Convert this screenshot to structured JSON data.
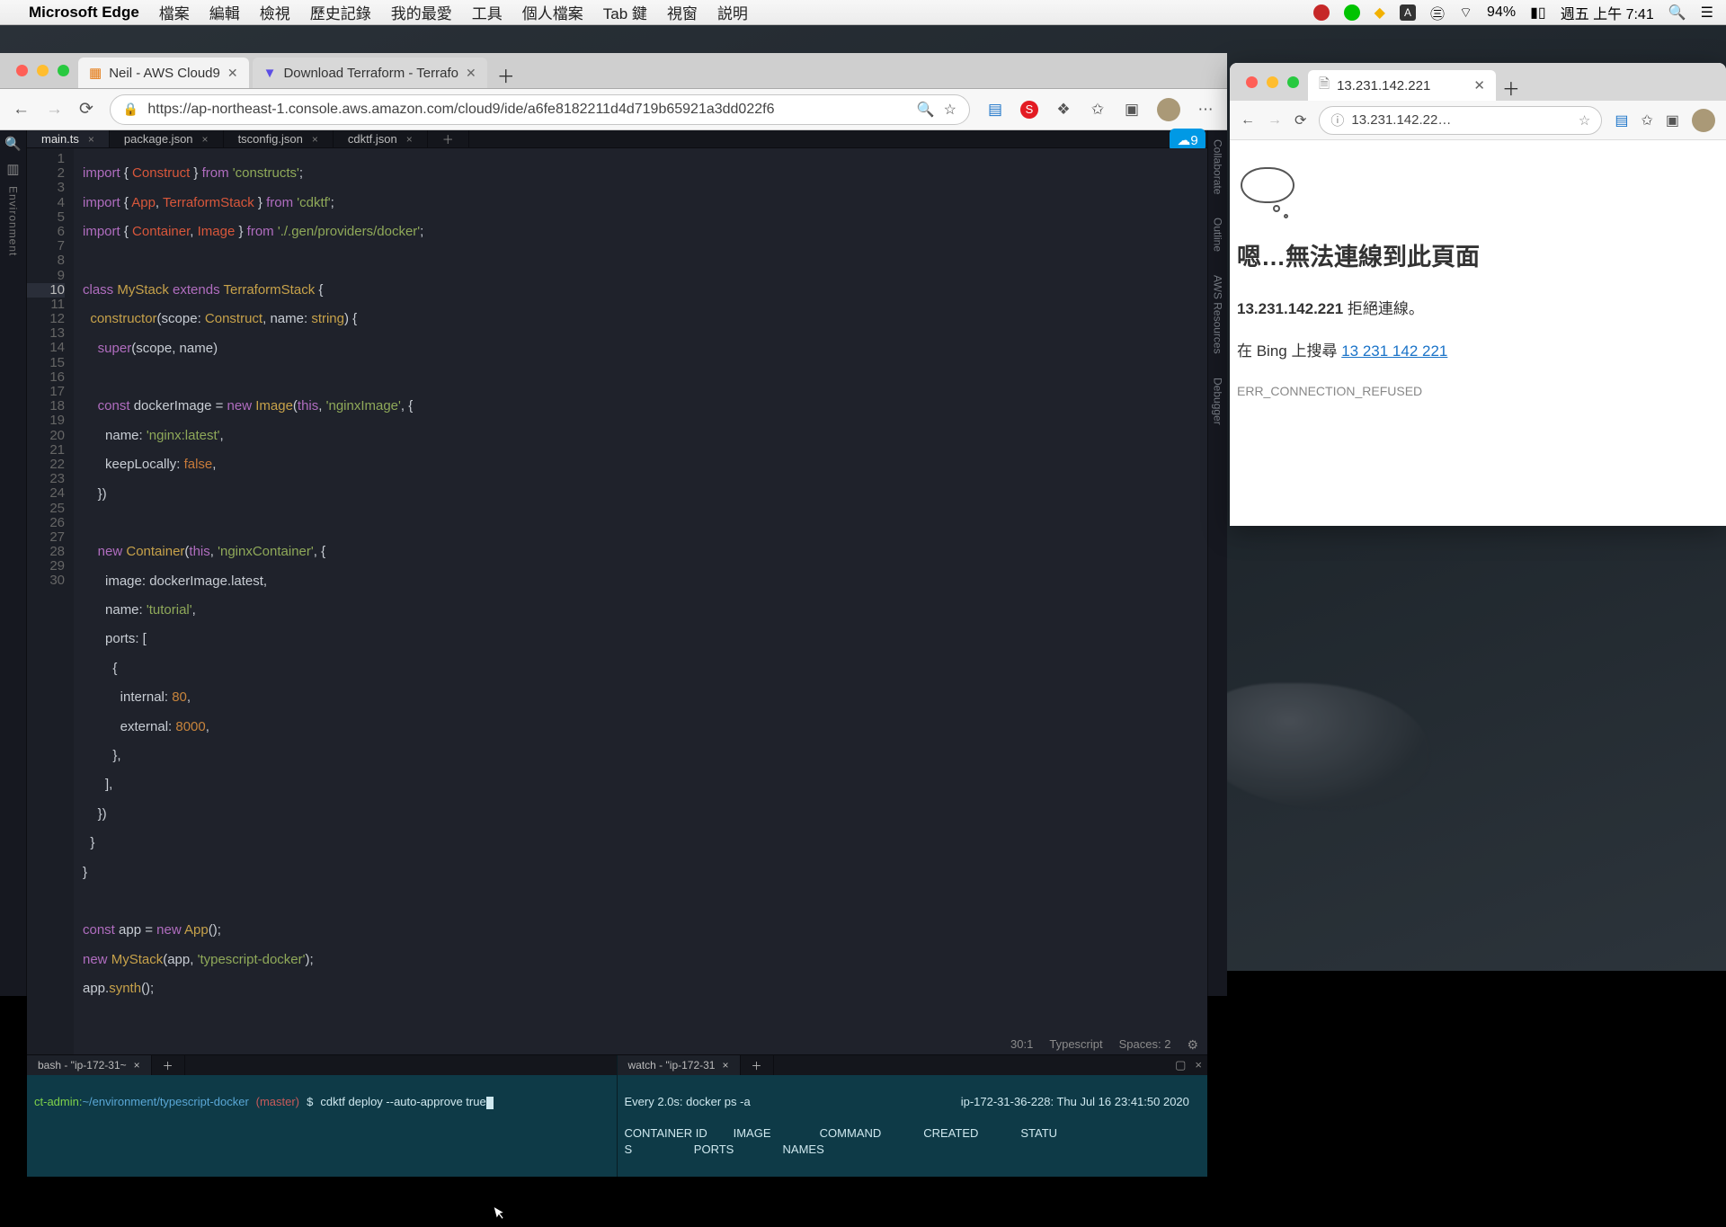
{
  "menubar": {
    "app": "Microsoft Edge",
    "items": [
      "檔案",
      "編輯",
      "檢視",
      "歷史記錄",
      "我的最愛",
      "工具",
      "個人檔案",
      "Tab 鍵",
      "視窗",
      "説明"
    ],
    "battery": "94%",
    "clock": "週五 上午 7:41"
  },
  "edge1": {
    "tabs": [
      {
        "title": "Neil - AWS Cloud9",
        "icon": "cloud9",
        "active": true
      },
      {
        "title": "Download Terraform - Terrafo",
        "icon": "terraform",
        "active": false
      }
    ],
    "url": "https://ap-northeast-1.console.aws.amazon.com/cloud9/ide/a6fe8182211d4d719b65921a3dd022f6"
  },
  "c9": {
    "left_label": "Environment",
    "right_labels": [
      "Collaborate",
      "Outline",
      "AWS Resources",
      "Debugger"
    ],
    "file_tabs": [
      "main.ts",
      "package.json",
      "tsconfig.json",
      "cdktf.json"
    ],
    "status": {
      "pos": "30:1",
      "lang": "Typescript",
      "spaces": "Spaces: 2"
    },
    "code_lines": 30,
    "terminals": {
      "left": {
        "tab": "bash - \"ip-172-31~",
        "prompt_user": "ct-admin:",
        "prompt_path": "~/environment/typescript-docker",
        "prompt_branch": "(master)",
        "cmd": "cdktf deploy --auto-approve true"
      },
      "right": {
        "tab": "watch - \"ip-172-31",
        "header_cmd": "Every 2.0s: docker ps -a",
        "header_host": "ip-172-31-36-228: Thu Jul 16 23:41:50 2020",
        "cols1": "CONTAINER ID        IMAGE               COMMAND             CREATED             STATU",
        "cols2": "S                   PORTS               NAMES"
      }
    }
  },
  "edge2": {
    "tab_title": "13.231.142.221",
    "url": "13.231.142.22…",
    "err_title": "嗯…無法連線到此頁面",
    "err_ip": "13.231.142.221",
    "err_refused": " 拒絕連線。",
    "err_search_prefix": "在 Bing 上搜尋 ",
    "err_search_link": "13 231 142 221",
    "err_code": "ERR_CONNECTION_REFUSED"
  }
}
